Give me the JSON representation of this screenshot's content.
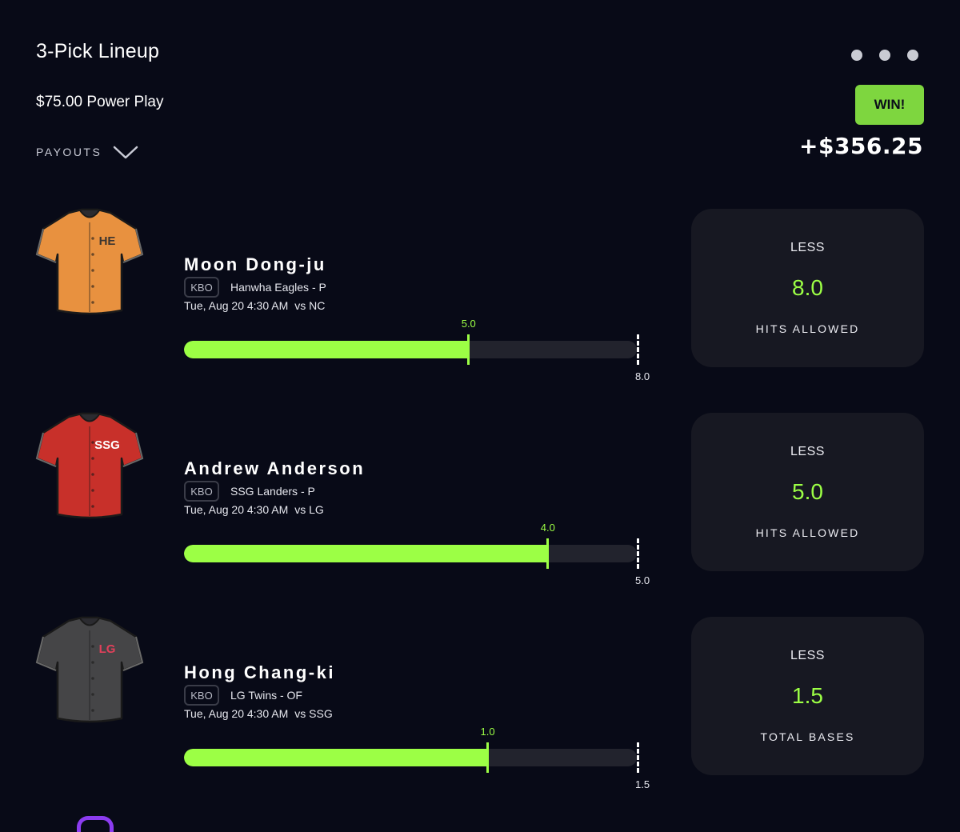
{
  "header": {
    "title": "3-Pick Lineup",
    "subtitle": "$75.00 Power Play",
    "payouts_label": "PAYOUTS",
    "result_badge": "WIN!",
    "winnings": "+$356.25"
  },
  "colors": {
    "background": "#080a17",
    "accent": "#9cff45",
    "win_badge": "#7ed63f",
    "card": "#171822"
  },
  "picks": [
    {
      "player": "Moon Dong-ju",
      "league": "KBO",
      "team": "Hanwha Eagles - P",
      "time": "Tue, Aug 20 4:30 AM",
      "opponent": "vs NC",
      "current": "5.0",
      "goal": "8.0",
      "progress": 0.625,
      "direction": "LESS",
      "line": "8.0",
      "stat": "HITS ALLOWED",
      "jersey_text": "HE",
      "jersey_color": "#e8913f",
      "jersey_text_color": "#3b3530"
    },
    {
      "player": "Andrew Anderson",
      "league": "KBO",
      "team": "SSG Landers - P",
      "time": "Tue, Aug 20 4:30 AM",
      "opponent": "vs LG",
      "current": "4.0",
      "goal": "5.0",
      "progress": 0.8,
      "direction": "LESS",
      "line": "5.0",
      "stat": "HITS ALLOWED",
      "jersey_text": "SSG",
      "jersey_color": "#c8302a",
      "jersey_text_color": "#ffffff"
    },
    {
      "player": "Hong Chang-ki",
      "league": "KBO",
      "team": "LG Twins - OF",
      "time": "Tue, Aug 20 4:30 AM",
      "opponent": "vs SSG",
      "current": "1.0",
      "goal": "1.5",
      "progress": 0.667,
      "direction": "LESS",
      "line": "1.5",
      "stat": "TOTAL BASES",
      "jersey_text": "LG",
      "jersey_color": "#454547",
      "jersey_text_color": "#e0405a"
    }
  ]
}
